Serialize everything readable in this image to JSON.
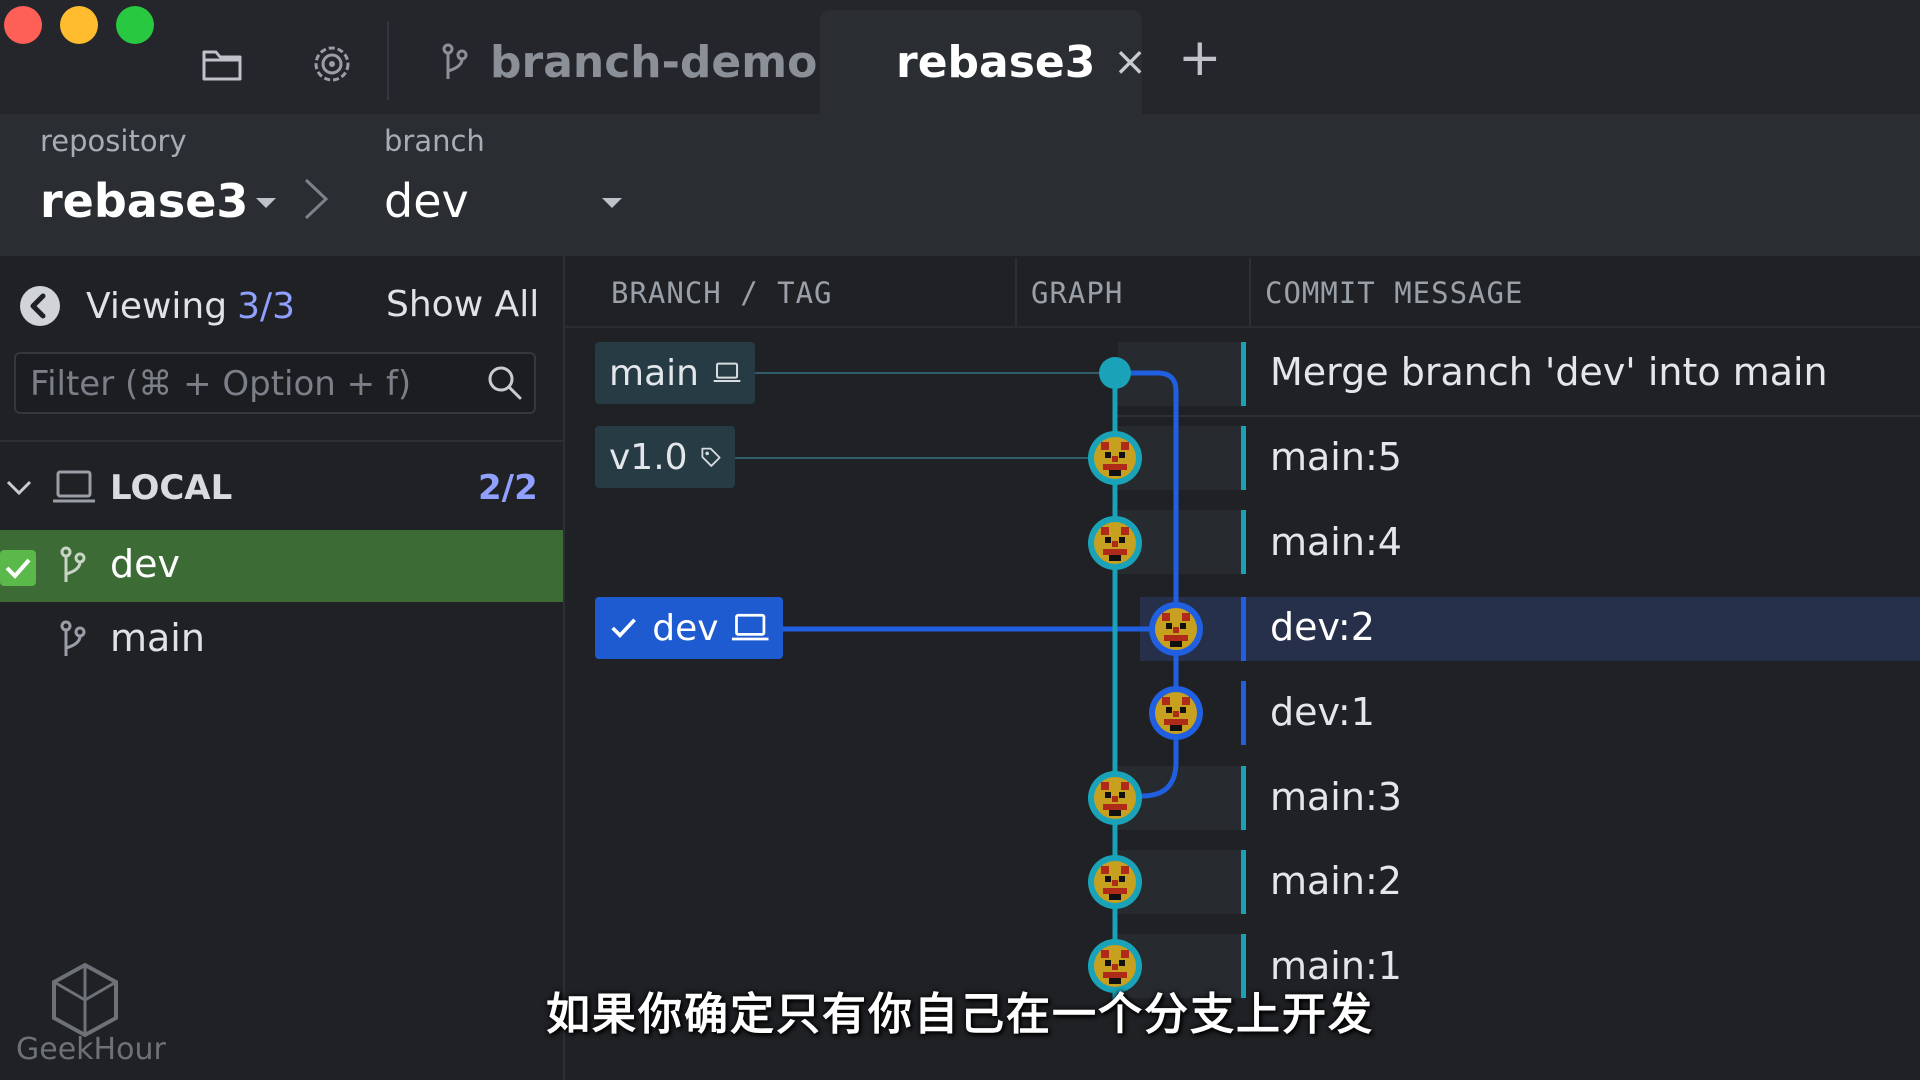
{
  "tabs": [
    {
      "label": "branch-demo",
      "active": false
    },
    {
      "label": "rebase3",
      "active": true
    }
  ],
  "tab_close": "×",
  "tab_add": "+",
  "header": {
    "repository_label": "repository",
    "repository_name": "rebase3",
    "branch_label": "branch",
    "branch_name": "dev"
  },
  "sidebar": {
    "viewing_label": "Viewing",
    "viewing_count": "3/3",
    "show_all": "Show All",
    "filter_placeholder": "Filter (⌘ + Option + f)",
    "local_label": "LOCAL",
    "local_count": "2/2",
    "branches": [
      {
        "name": "dev",
        "checked": true
      },
      {
        "name": "main",
        "checked": false
      }
    ]
  },
  "columns": {
    "branch_tag": "BRANCH / TAG",
    "graph": "GRAPH",
    "commit_message": "COMMIT MESSAGE"
  },
  "refs": {
    "main": "main",
    "tag": "v1.0",
    "dev": "dev"
  },
  "commits": [
    "Merge branch 'dev' into main",
    "main:5",
    "main:4",
    "dev:2",
    "dev:1",
    "main:3",
    "main:2",
    "main:1"
  ],
  "watermark": "GeekHour",
  "subtitle": "如果你确定只有你自己在一个分支上开发",
  "colors": {
    "accent": "#8fa0ff",
    "main_lane": "#1aa3b8",
    "dev_lane": "#1f5fe0",
    "active_branch_row": "#3c6b36",
    "selected_row": "#27304a"
  }
}
